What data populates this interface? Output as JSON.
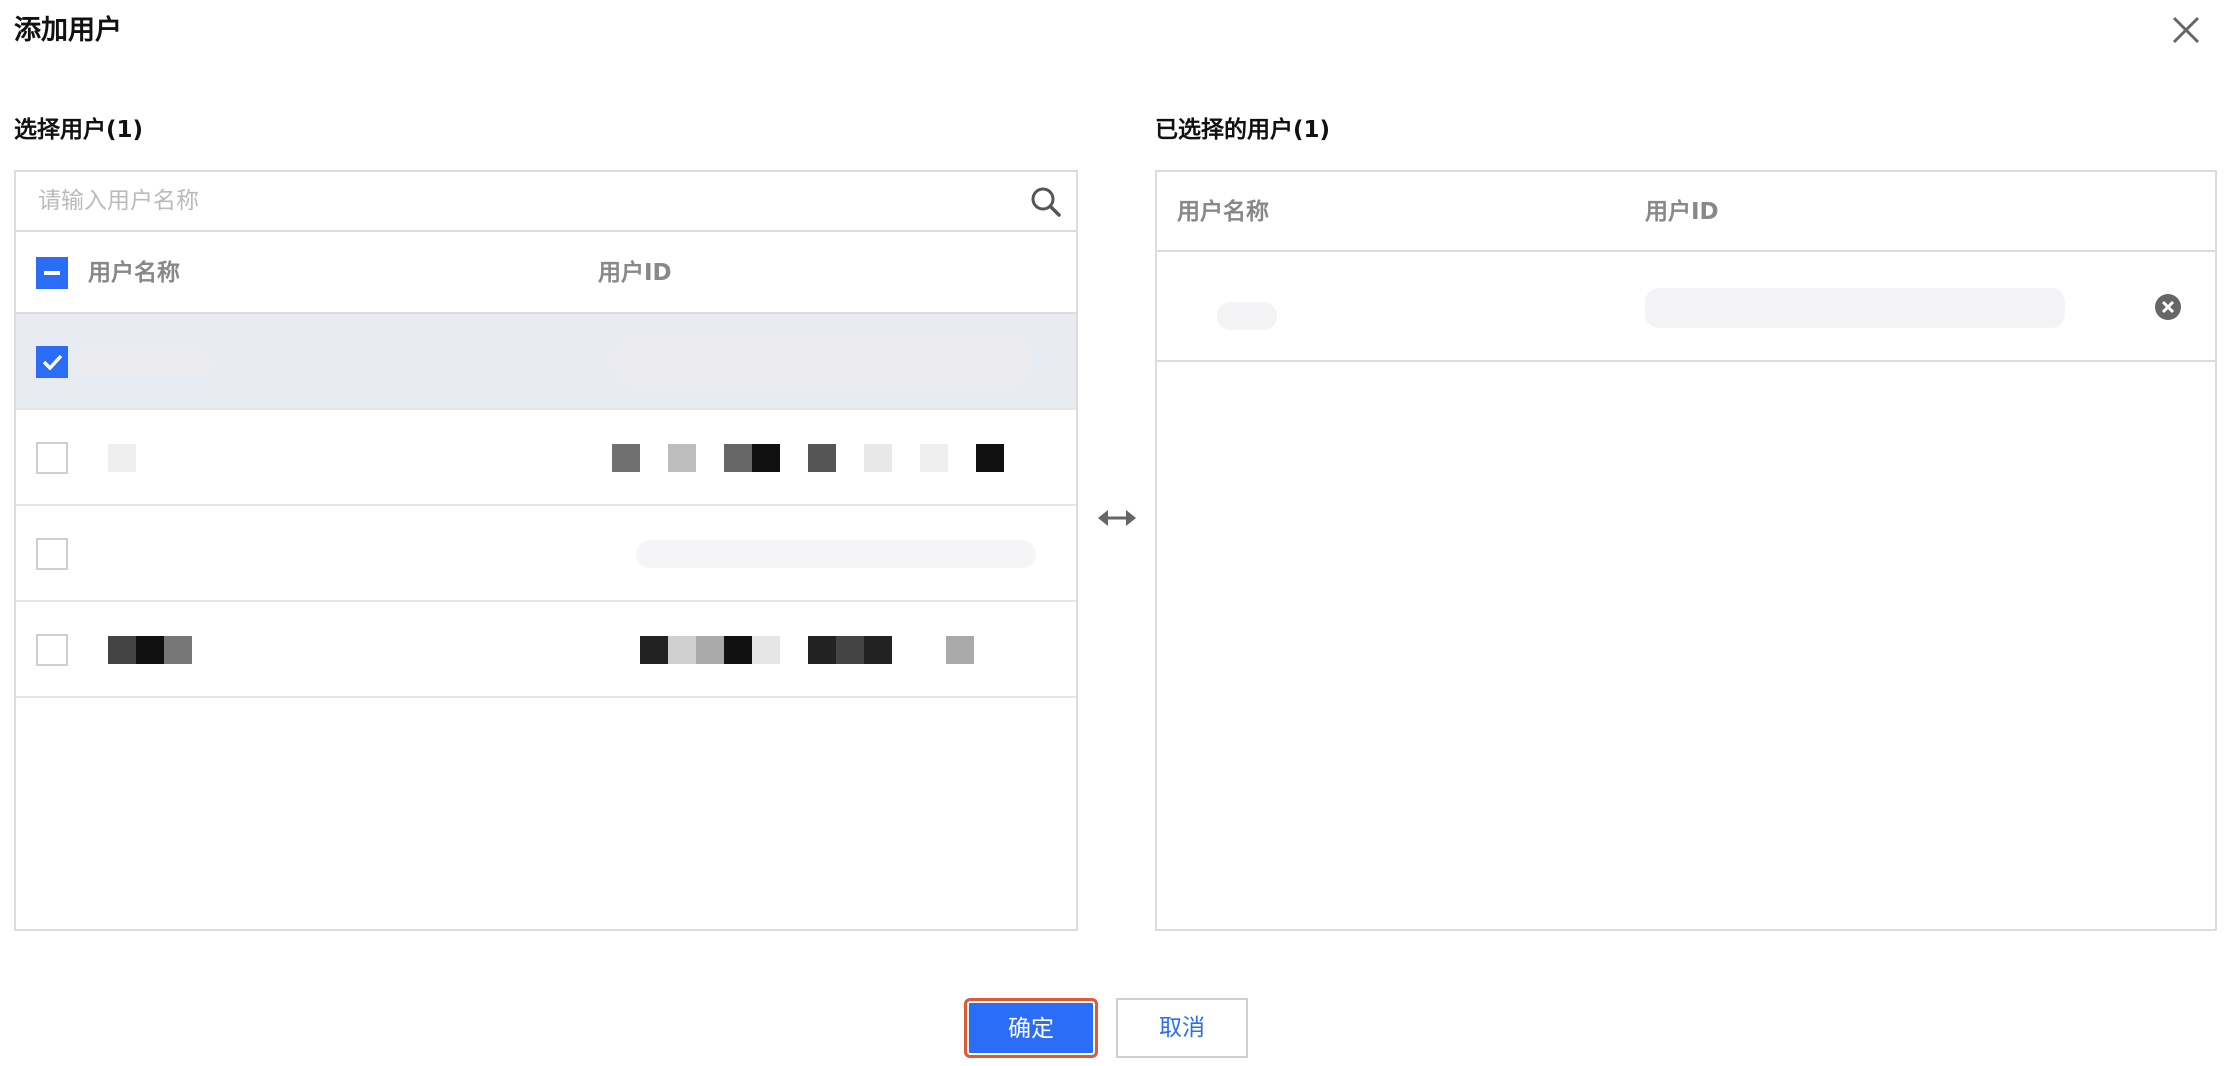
{
  "dialog": {
    "title": "添加用户",
    "close_icon": "close-icon"
  },
  "left": {
    "label": "选择用户(1)",
    "search_placeholder": "请输入用户名称",
    "search_icon": "search-icon",
    "col_name": "用户名称",
    "col_id": "用户ID",
    "rows": [
      {
        "checked": true
      },
      {
        "checked": false
      },
      {
        "checked": false
      },
      {
        "checked": false
      }
    ]
  },
  "transfer_icon": "transfer-arrows-icon",
  "right": {
    "label": "已选择的用户(1)",
    "col_name": "用户名称",
    "col_id": "用户ID",
    "remove_icon": "remove-circle-icon"
  },
  "footer": {
    "confirm": "确定",
    "cancel": "取消"
  },
  "colors": {
    "primary": "#2b6df6",
    "border": "#dcdcdc",
    "selected_row": "#e8ebf1",
    "highlight_outline": "#e05a3a"
  }
}
